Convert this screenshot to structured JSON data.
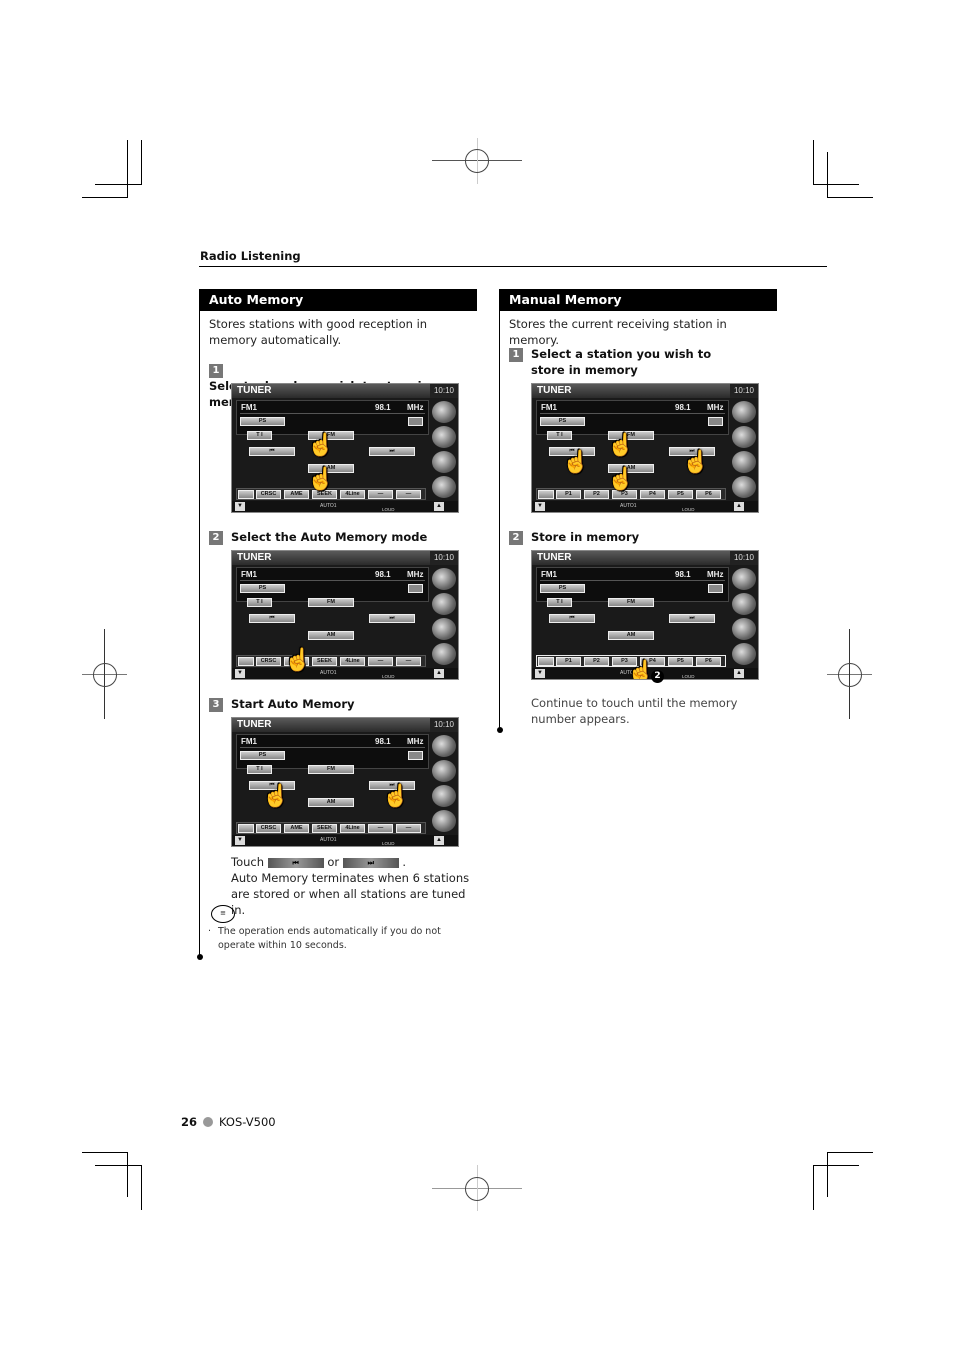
{
  "page": {
    "section_header": "Radio Listening",
    "page_number": "26",
    "model": "KOS-V500"
  },
  "auto_memory": {
    "title": "Auto Memory",
    "description": "Stores stations with good reception in memory automatically.",
    "steps": [
      {
        "number": "1",
        "text": "Select a band you wish to store in memory"
      },
      {
        "number": "2",
        "text": "Select the Auto Memory mode"
      },
      {
        "number": "3",
        "text": "Start Auto Memory"
      }
    ],
    "touch_prefix": "Touch",
    "touch_or": "or",
    "touch_suffix": ".",
    "after_text": "Auto Memory terminates when 6 stations are stored or when all stations are tuned in.",
    "note_icon": "note-speech-bubble-icon",
    "note": "The operation ends automatically if you do not operate within 10 seconds."
  },
  "manual_memory": {
    "title": "Manual Memory",
    "description": "Stores the current receiving station in memory.",
    "steps": [
      {
        "number": "1",
        "text": "Select a station you wish to store in memory"
      },
      {
        "number": "2",
        "text": "Store in memory"
      }
    ],
    "after_text": "Continue to touch until the memory number appears.",
    "callout_number": "2"
  },
  "tuner_screen": {
    "title": "TUNER",
    "clock": "10:10",
    "band": "FM1",
    "frequency": "98.1",
    "unit": "MHz",
    "ps_label": "PS",
    "ti_label": "T I",
    "fm_label": "FM",
    "am_label": "AM",
    "seek_prev_icon": "⏮",
    "seek_next_icon": "⏭",
    "function_buttons": [
      "CRSC",
      "AME",
      "SEEK",
      "4Line",
      "—",
      "—"
    ],
    "preset_buttons": [
      "P1",
      "P2",
      "P3",
      "P4",
      "P5",
      "P6"
    ],
    "status_auto": "AUTO1",
    "status_loud": "LOUD",
    "hand_icon": "☝"
  }
}
